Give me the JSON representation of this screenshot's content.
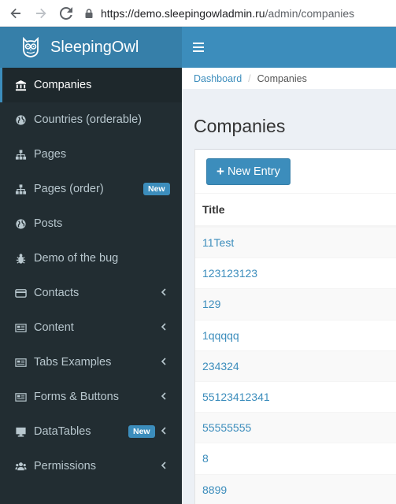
{
  "browser": {
    "url_host": "https://demo.sleepingowladmin.ru",
    "url_path": "/admin/companies"
  },
  "brand": {
    "name": "SleepingOwl"
  },
  "sidebar": {
    "items": [
      {
        "label": "Companies",
        "icon": "bank-icon"
      },
      {
        "label": "Countries (orderable)",
        "icon": "globe-icon"
      },
      {
        "label": "Pages",
        "icon": "sitemap-icon"
      },
      {
        "label": "Pages (order)",
        "icon": "sitemap-icon",
        "badge": "New"
      },
      {
        "label": "Posts",
        "icon": "globe-icon"
      },
      {
        "label": "Demo of the bug",
        "icon": "bug-icon"
      },
      {
        "label": "Contacts",
        "icon": "credit-card-icon"
      },
      {
        "label": "Content",
        "icon": "newspaper-icon"
      },
      {
        "label": "Tabs Examples",
        "icon": "newspaper-icon"
      },
      {
        "label": "Forms & Buttons",
        "icon": "newspaper-icon"
      },
      {
        "label": "DataTables",
        "icon": "desktop-icon",
        "badge": "New"
      },
      {
        "label": "Permissions",
        "icon": "users-icon"
      }
    ]
  },
  "breadcrumb": {
    "home": "Dashboard",
    "current": "Companies"
  },
  "main": {
    "title": "Companies",
    "new_entry_label": "New Entry",
    "table": {
      "header": "Title",
      "rows": [
        "11Test",
        "123123123",
        "129",
        "1qqqqq",
        "234324",
        "55123412341",
        "55555555",
        "8",
        "8899"
      ]
    }
  },
  "colors": {
    "accent": "#3c8dbc",
    "sidebar_bg": "#222d32",
    "brand_bg": "#367fa9"
  }
}
